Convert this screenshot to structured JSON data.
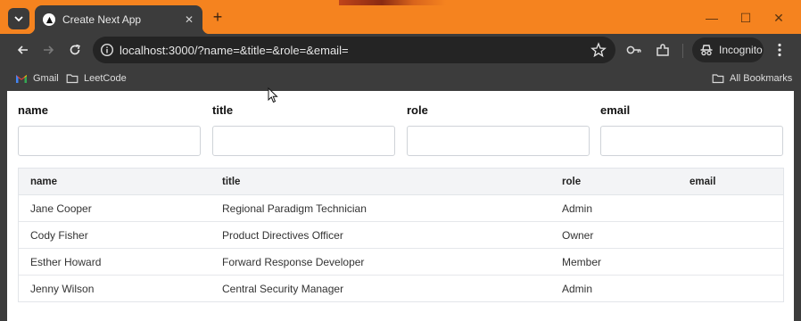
{
  "browser": {
    "tab": {
      "title": "Create Next App"
    },
    "address_bar": {
      "url": "localhost:3000/?name=&title=&role=&email="
    },
    "profile": {
      "label": "Incognito"
    },
    "bookmarks": [
      {
        "label": "Gmail",
        "icon": "gmail-icon"
      },
      {
        "label": "LeetCode",
        "icon": "folder-icon"
      }
    ],
    "all_bookmarks_label": "All Bookmarks",
    "colors": {
      "tabstrip": "#f5831f",
      "toolbar": "#3c3c3c",
      "omnibox": "#242424"
    }
  },
  "filters": {
    "name": {
      "label": "name",
      "value": ""
    },
    "title": {
      "label": "title",
      "value": ""
    },
    "role": {
      "label": "role",
      "value": ""
    },
    "email": {
      "label": "email",
      "value": ""
    }
  },
  "table": {
    "headers": [
      "name",
      "title",
      "role",
      "email"
    ],
    "rows": [
      {
        "name": "Jane Cooper",
        "title": "Regional Paradigm Technician",
        "role": "Admin",
        "email": ""
      },
      {
        "name": "Cody Fisher",
        "title": "Product Directives Officer",
        "role": "Owner",
        "email": ""
      },
      {
        "name": "Esther Howard",
        "title": "Forward Response Developer",
        "role": "Member",
        "email": ""
      },
      {
        "name": "Jenny Wilson",
        "title": "Central Security Manager",
        "role": "Admin",
        "email": ""
      }
    ]
  }
}
